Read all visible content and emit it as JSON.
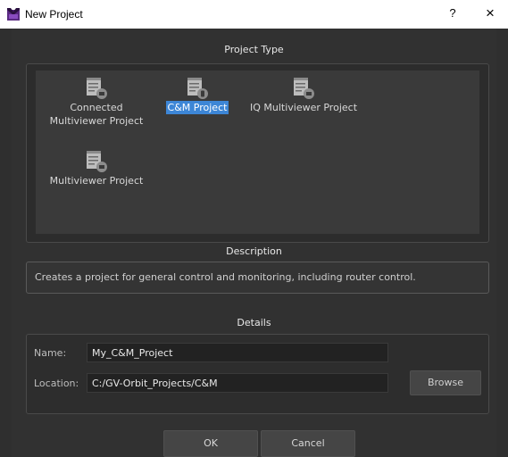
{
  "window": {
    "title": "New Project",
    "help": "?",
    "close": "×"
  },
  "project_type": {
    "heading": "Project Type",
    "items": [
      {
        "label_line1": "Connected",
        "label_line2": "Multiviewer Project",
        "icon": "connected-multiviewer-project-icon",
        "selected": false
      },
      {
        "label_line1": "C&M Project",
        "label_line2": "",
        "icon": "cm-project-icon",
        "selected": true
      },
      {
        "label_line1": "IQ Multiviewer Project",
        "label_line2": "",
        "icon": "iq-multiviewer-project-icon",
        "selected": false
      },
      {
        "label_line1": "Multiviewer Project",
        "label_line2": "",
        "icon": "multiviewer-project-icon",
        "selected": false
      }
    ]
  },
  "description": {
    "heading": "Description",
    "text": "Creates a project for general control and monitoring, including router control."
  },
  "details": {
    "heading": "Details",
    "name_label": "Name:",
    "name_value": "My_C&M_Project",
    "location_label": "Location:",
    "location_value": "C:/GV-Orbit_Projects/C&M",
    "browse_label": "Browse"
  },
  "buttons": {
    "ok": "OK",
    "cancel": "Cancel"
  },
  "colors": {
    "selection": "#3d86d6",
    "background": "#313131",
    "brand": "#6a2c8e"
  }
}
